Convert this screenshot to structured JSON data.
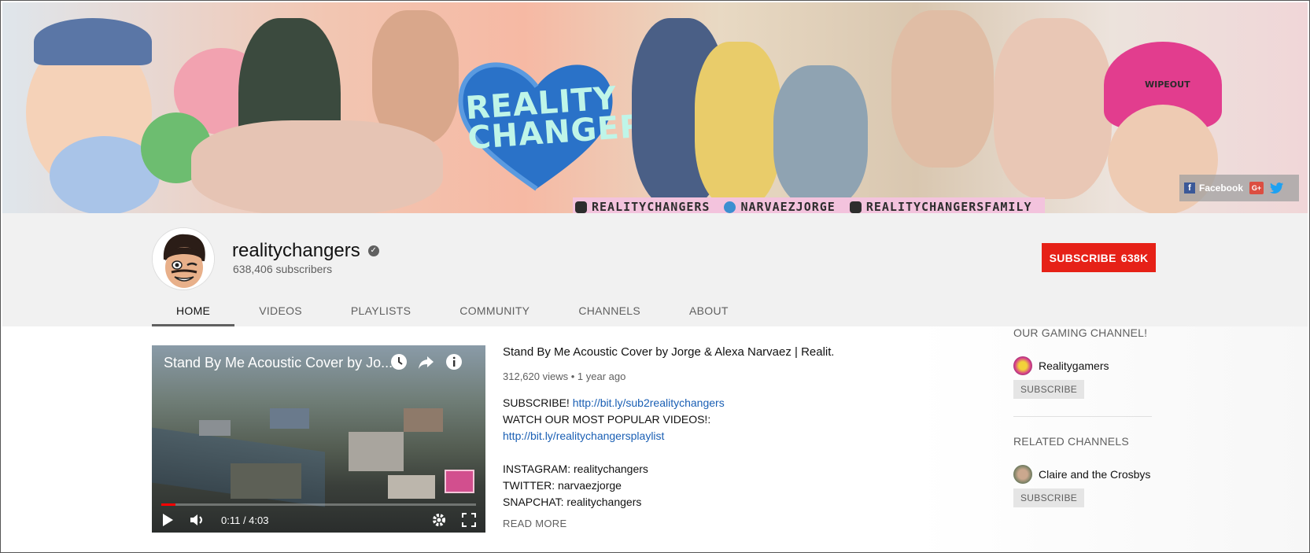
{
  "banner": {
    "heart_text_line1": "REALITY",
    "heart_text_line2": "CHANGERS",
    "social": [
      {
        "icon": "instagram-icon",
        "label": "REALITYCHANGERS"
      },
      {
        "icon": "telegram-icon",
        "label": "NARVAEZJORGE"
      },
      {
        "icon": "facebook-icon",
        "label": "REALITYCHANGERSFAMILY"
      }
    ],
    "links": {
      "facebook_label": "Facebook",
      "gplus_label": "G+"
    },
    "helmet_text": "WIPEOUT"
  },
  "channel": {
    "name": "realitychangers",
    "subscribers": "638,406 subscribers",
    "subscribe_label": "SUBSCRIBE",
    "subscribe_count": "638K"
  },
  "tabs": [
    {
      "label": "HOME",
      "active": true
    },
    {
      "label": "VIDEOS"
    },
    {
      "label": "PLAYLISTS"
    },
    {
      "label": "COMMUNITY"
    },
    {
      "label": "CHANNELS"
    },
    {
      "label": "ABOUT"
    }
  ],
  "featured": {
    "player_title": "Stand By Me Acoustic Cover by Jo...",
    "time": "0:11 / 4:03",
    "progress_fraction": 0.045,
    "title": "Stand By Me Acoustic Cover by Jorge & Alexa Narvaez | Realit...",
    "views": "312,620 views",
    "age": "1 year ago",
    "desc_line1_text": "SUBSCRIBE! ",
    "desc_line1_link": "http://bit.ly/sub2realitychangers",
    "desc_line2": "WATCH OUR MOST POPULAR VIDEOS!:",
    "desc_line3_link": "http://bit.ly/realitychangersplaylist",
    "desc_line5": "INSTAGRAM: realitychangers",
    "desc_line6": "TWITTER: narvaezjorge",
    "desc_line7": "SNAPCHAT: realitychangers",
    "read_more": "READ MORE"
  },
  "sidebar": {
    "section1_title": "OUR GAMING CHANNEL!",
    "section1_channel": "Realitygamers",
    "section2_title": "RELATED CHANNELS",
    "section2_channel": "Claire and the Crosbys",
    "subscribe_label": "SUBSCRIBE"
  }
}
